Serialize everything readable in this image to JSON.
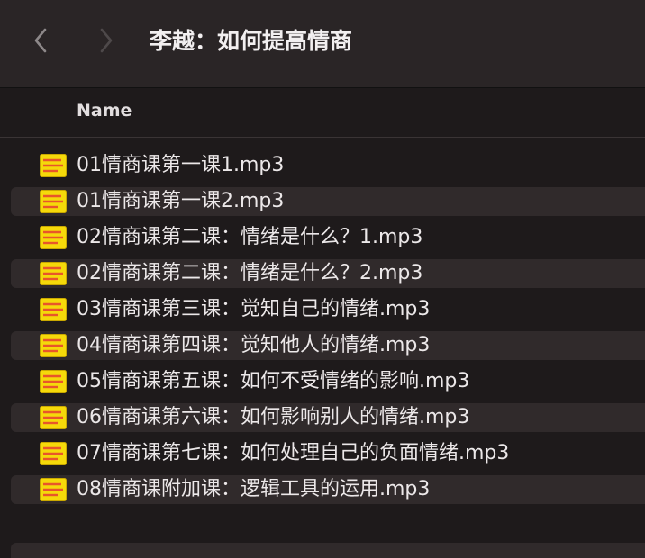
{
  "window": {
    "title": "李越：如何提高情商"
  },
  "toolbar": {
    "back_icon": "chevron-left-icon",
    "forward_icon": "chevron-right-icon"
  },
  "columns": {
    "name": "Name"
  },
  "files": [
    {
      "name": "01情商课第一课1.mp3",
      "icon": "text-document-icon"
    },
    {
      "name": "01情商课第一课2.mp3",
      "icon": "text-document-icon"
    },
    {
      "name": "02情商课第二课：情绪是什么？1.mp3",
      "icon": "text-document-icon"
    },
    {
      "name": "02情商课第二课：情绪是什么？2.mp3",
      "icon": "text-document-icon"
    },
    {
      "name": "03情商课第三课：觉知自己的情绪.mp3",
      "icon": "text-document-icon"
    },
    {
      "name": "04情商课第四课：觉知他人的情绪.mp3",
      "icon": "text-document-icon"
    },
    {
      "name": "05情商课第五课：如何不受情绪的影响.mp3",
      "icon": "text-document-icon"
    },
    {
      "name": "06情商课第六课：如何影响别人的情绪.mp3",
      "icon": "text-document-icon"
    },
    {
      "name": "07情商课第七课：如何处理自己的负面情绪.mp3",
      "icon": "text-document-icon"
    },
    {
      "name": "08情商课附加课：逻辑工具的运用.mp3",
      "icon": "text-document-icon"
    }
  ],
  "colors": {
    "background": "#1e1a1b",
    "toolbar": "#2a2526",
    "alt_row": "#302a2b",
    "icon_yellow": "#f5d90a",
    "icon_lines": "#e8562a"
  }
}
